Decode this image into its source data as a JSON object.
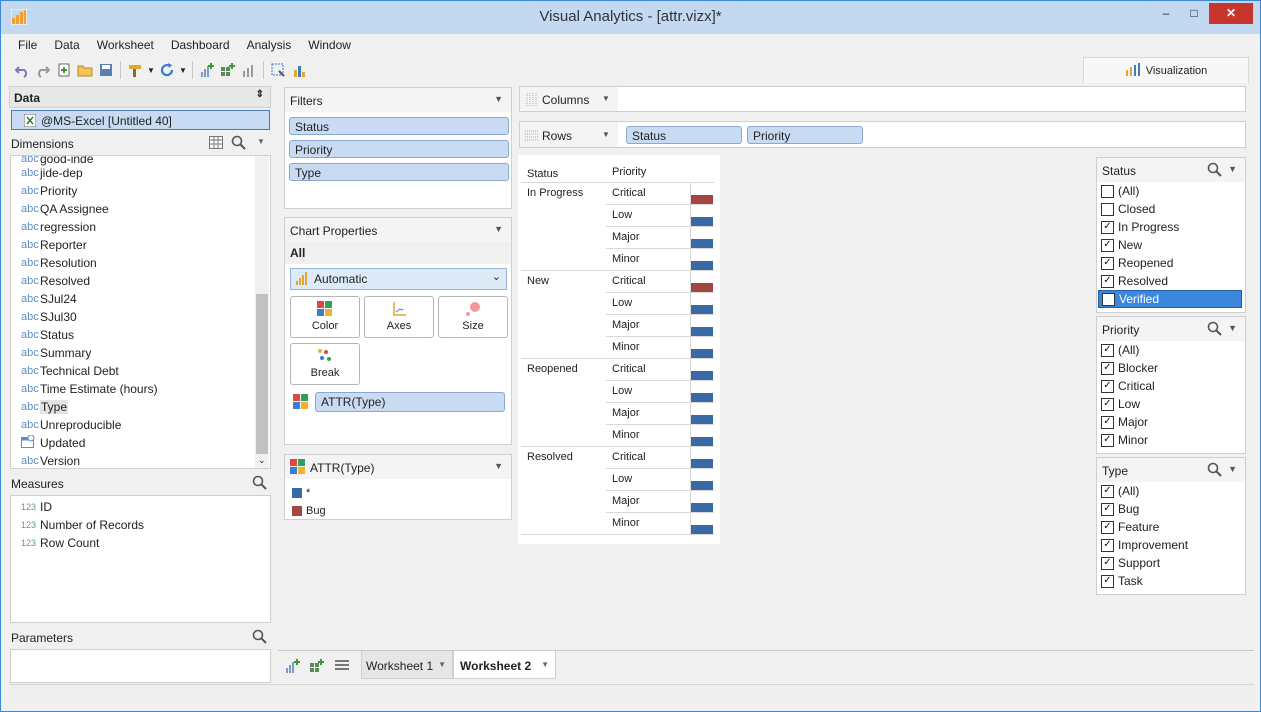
{
  "window": {
    "title": "Visual Analytics - [attr.vizx]*",
    "min": "‒",
    "max": "□",
    "close": "✕"
  },
  "menu": [
    "File",
    "Data",
    "Worksheet",
    "Dashboard",
    "Analysis",
    "Window"
  ],
  "toolbar_icons": [
    "undo-icon",
    "redo-icon",
    "new-sheet-icon",
    "open-folder-icon",
    "save-icon",
    "brush-icon",
    "dropdown-icon",
    "refresh-icon",
    "dropdown-icon",
    "add-chart-icon",
    "add-grid-icon",
    "bar-chart-icon",
    "select-icon",
    "sort-icon"
  ],
  "visualization_tab": "Visualization",
  "data_panel": {
    "title": "Data",
    "source": "@MS-Excel [Untitled 40]",
    "dimensions_label": "Dimensions",
    "partial_item": "good-inde",
    "dimensions": [
      {
        "type": "abc",
        "name": "jide-dep"
      },
      {
        "type": "abc",
        "name": "Priority"
      },
      {
        "type": "abc",
        "name": "QA Assignee"
      },
      {
        "type": "abc",
        "name": "regression"
      },
      {
        "type": "abc",
        "name": "Reporter"
      },
      {
        "type": "abc",
        "name": "Resolution"
      },
      {
        "type": "abc",
        "name": "Resolved"
      },
      {
        "type": "abc",
        "name": "SJul24"
      },
      {
        "type": "abc",
        "name": "SJul30"
      },
      {
        "type": "abc",
        "name": "Status"
      },
      {
        "type": "abc",
        "name": "Summary"
      },
      {
        "type": "abc",
        "name": "Technical Debt"
      },
      {
        "type": "abc",
        "name": "Time Estimate (hours)"
      },
      {
        "type": "abc",
        "name": "Type"
      },
      {
        "type": "abc",
        "name": "Unreproducible"
      },
      {
        "type": "date",
        "name": "Updated"
      },
      {
        "type": "abc",
        "name": "Version"
      }
    ],
    "measures_label": "Measures",
    "measures": [
      {
        "type": "123",
        "name": "ID"
      },
      {
        "type": "123",
        "name": "Number of Records"
      },
      {
        "type": "123",
        "name": "Row Count"
      }
    ],
    "parameters_label": "Parameters"
  },
  "filters": {
    "title": "Filters",
    "items": [
      "Status",
      "Priority",
      "Type"
    ]
  },
  "chart_properties": {
    "title": "Chart Properties",
    "scope": "All",
    "chart_type": "Automatic",
    "buttons": [
      "Color",
      "Axes",
      "Size",
      "Break"
    ],
    "color_field": "ATTR(Type)"
  },
  "legend": {
    "title": "ATTR(Type)",
    "items": [
      {
        "label": "*",
        "color": "#3a6aa6"
      },
      {
        "label": "Bug",
        "color": "#a24744"
      }
    ]
  },
  "shelves": {
    "columns_label": "Columns",
    "rows_label": "Rows",
    "rows": [
      "Status",
      "Priority"
    ]
  },
  "table": {
    "header_status": "Status",
    "header_priority": "Priority",
    "groups": [
      {
        "status": "In Progress",
        "rows": [
          {
            "p": "Critical",
            "c": "#a24744"
          },
          {
            "p": "Low",
            "c": "#3a6aa6"
          },
          {
            "p": "Major",
            "c": "#3a6aa6"
          },
          {
            "p": "Minor",
            "c": "#3a6aa6"
          }
        ]
      },
      {
        "status": "New",
        "rows": [
          {
            "p": "Critical",
            "c": "#a24744"
          },
          {
            "p": "Low",
            "c": "#3a6aa6"
          },
          {
            "p": "Major",
            "c": "#3a6aa6"
          },
          {
            "p": "Minor",
            "c": "#3a6aa6"
          }
        ]
      },
      {
        "status": "Reopened",
        "rows": [
          {
            "p": "Critical",
            "c": "#3a6aa6"
          },
          {
            "p": "Low",
            "c": "#3a6aa6"
          },
          {
            "p": "Major",
            "c": "#3a6aa6"
          },
          {
            "p": "Minor",
            "c": "#3a6aa6"
          }
        ]
      },
      {
        "status": "Resolved",
        "rows": [
          {
            "p": "Critical",
            "c": "#3a6aa6"
          },
          {
            "p": "Low",
            "c": "#3a6aa6"
          },
          {
            "p": "Major",
            "c": "#3a6aa6"
          },
          {
            "p": "Minor",
            "c": "#3a6aa6"
          }
        ]
      }
    ]
  },
  "filter_cards": [
    {
      "title": "Status",
      "items": [
        {
          "label": "(All)",
          "checked": false
        },
        {
          "label": "Closed",
          "checked": false
        },
        {
          "label": "In Progress",
          "checked": true
        },
        {
          "label": "New",
          "checked": true
        },
        {
          "label": "Reopened",
          "checked": true
        },
        {
          "label": "Resolved",
          "checked": true
        },
        {
          "label": "Verified",
          "checked": false,
          "selected": true
        }
      ]
    },
    {
      "title": "Priority",
      "items": [
        {
          "label": "(All)",
          "checked": true
        },
        {
          "label": "Blocker",
          "checked": true
        },
        {
          "label": "Critical",
          "checked": true
        },
        {
          "label": "Low",
          "checked": true
        },
        {
          "label": "Major",
          "checked": true
        },
        {
          "label": "Minor",
          "checked": true
        }
      ]
    },
    {
      "title": "Type",
      "items": [
        {
          "label": "(All)",
          "checked": true
        },
        {
          "label": "Bug",
          "checked": true
        },
        {
          "label": "Feature",
          "checked": true
        },
        {
          "label": "Improvement",
          "checked": true
        },
        {
          "label": "Support",
          "checked": true
        },
        {
          "label": "Task",
          "checked": true
        }
      ]
    }
  ],
  "worksheet_tabs": [
    {
      "label": "Worksheet 1",
      "active": false
    },
    {
      "label": "Worksheet 2",
      "active": true
    }
  ],
  "colors": {
    "accent": "#3c8ad6",
    "pill": "#c9dbf3",
    "bug": "#a24744",
    "other": "#3a6aa6",
    "selection": "#3d86dd"
  }
}
